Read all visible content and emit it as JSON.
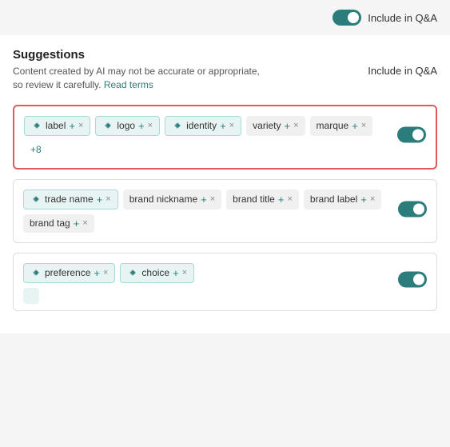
{
  "topBar": {
    "toggle_label": "Include in Q&A",
    "toggle_on": true
  },
  "suggestions": {
    "title": "Suggestions",
    "description": "Content created by AI may not be accurate or appropriate, so review it carefully.",
    "read_terms_label": "Read terms",
    "column_header": "Include in Q&A"
  },
  "cards": [
    {
      "id": "card-1",
      "selected": true,
      "toggle_on": true,
      "tags": [
        {
          "type": "ai",
          "text": "label",
          "has_ai": true
        },
        {
          "type": "ai",
          "text": "logo",
          "has_ai": true
        },
        {
          "type": "ai",
          "text": "identity",
          "has_ai": true
        },
        {
          "type": "plain",
          "text": "variety",
          "has_ai": false
        },
        {
          "type": "plain",
          "text": "marque",
          "has_ai": false
        }
      ],
      "more": "+8"
    },
    {
      "id": "card-2",
      "selected": false,
      "toggle_on": true,
      "tags": [
        {
          "type": "ai",
          "text": "trade name",
          "has_ai": true
        },
        {
          "type": "plain",
          "text": "brand nickname",
          "has_ai": false
        },
        {
          "type": "plain",
          "text": "brand title",
          "has_ai": false
        },
        {
          "type": "plain",
          "text": "brand label",
          "has_ai": false
        },
        {
          "type": "plain",
          "text": "brand tag",
          "has_ai": false
        }
      ],
      "more": null
    },
    {
      "id": "card-3",
      "selected": false,
      "toggle_on": true,
      "tags": [
        {
          "type": "ai",
          "text": "preference",
          "has_ai": true
        },
        {
          "type": "ai",
          "text": "choice",
          "has_ai": true
        }
      ],
      "more": null,
      "partial": true
    }
  ],
  "icons": {
    "ai_diamond": "◈",
    "plus": "+",
    "times": "×"
  }
}
